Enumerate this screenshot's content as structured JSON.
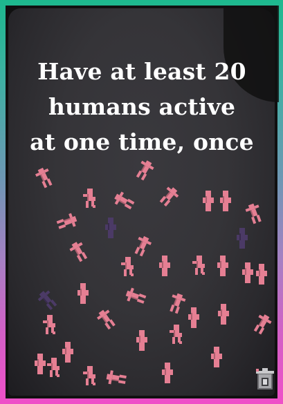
{
  "card": {
    "title_lines": [
      "Have at least 20",
      "humans active",
      "at one time, once"
    ]
  },
  "colors": {
    "frame_top": "#1db98e",
    "frame_bottom": "#ef4fc8",
    "card_face": "#353438",
    "human_active": "#e57f93",
    "human_dim": "#a95f80",
    "human_shadow": "#4b3a66"
  },
  "icons": {
    "corner": "trash-bin-icon"
  }
}
